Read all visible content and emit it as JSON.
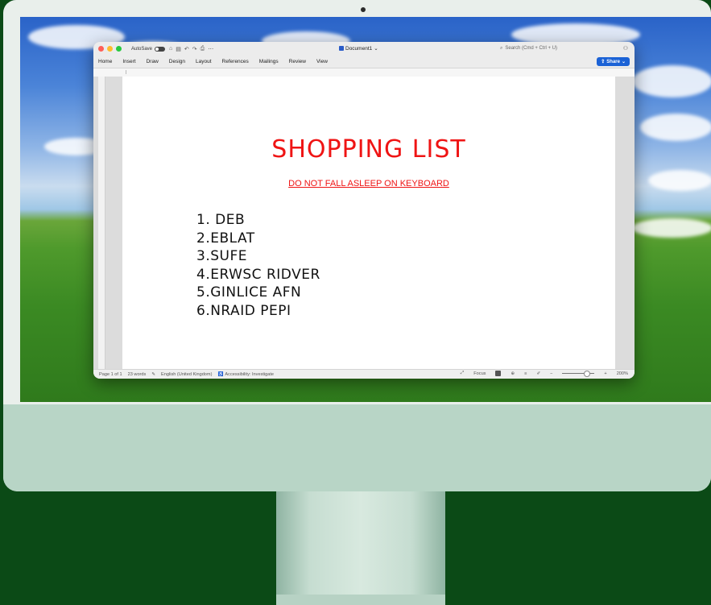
{
  "window": {
    "autosave_label": "AutoSave",
    "document_title": "Document1",
    "search_placeholder": "Search (Cmd + Ctrl + U)"
  },
  "ribbon": {
    "tabs": [
      "Home",
      "Insert",
      "Draw",
      "Design",
      "Layout",
      "References",
      "Mailings",
      "Review",
      "View"
    ],
    "share_label": "Share"
  },
  "document": {
    "heading": "SHOPPING LIST",
    "subheading": "DO NOT FALL ASLEEP ON KEYBOARD",
    "items": [
      "1. DEB",
      "2.EBLAT",
      "3.SUFE",
      "4.ERWSC RIDVER",
      "5.GINLICE AFN",
      "6.NRAID PEPI"
    ]
  },
  "statusbar": {
    "page": "Page 1 of 1",
    "words": "23 words",
    "language": "English (United Kingdom)",
    "accessibility": "Accessibility: Investigate",
    "focus": "Focus",
    "zoom": "200%"
  },
  "colors": {
    "heading": "#ef1414",
    "share_button": "#1b62d6",
    "imac_chin": "#b8d5c6",
    "background": "#0b4a16"
  },
  "icons": [
    "camera-icon",
    "home-icon",
    "save-icon",
    "undo-icon",
    "redo-icon",
    "print-icon",
    "more-icon",
    "search-icon",
    "person-icon",
    "share-icon",
    "proofing-icon",
    "accessibility-icon",
    "focus-icon",
    "print-layout-icon",
    "web-layout-icon",
    "outline-icon",
    "draft-icon"
  ]
}
